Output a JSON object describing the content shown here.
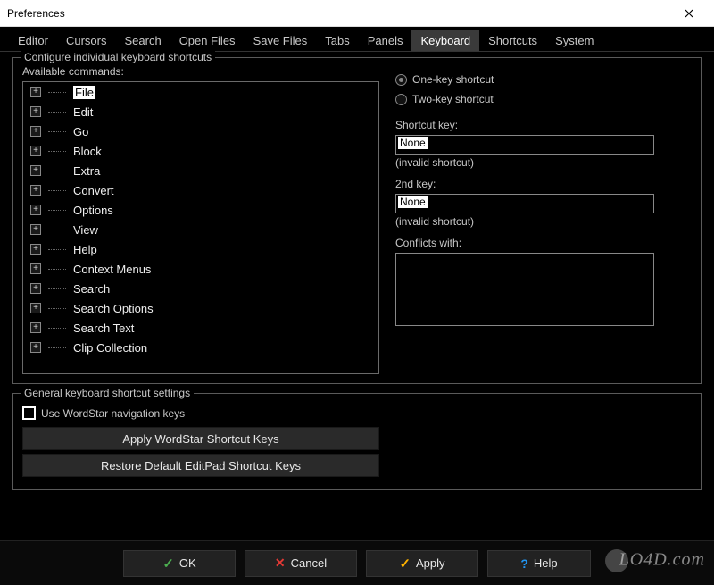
{
  "window": {
    "title": "Preferences"
  },
  "tabs": [
    {
      "label": "Editor"
    },
    {
      "label": "Cursors"
    },
    {
      "label": "Search"
    },
    {
      "label": "Open Files"
    },
    {
      "label": "Save Files"
    },
    {
      "label": "Tabs"
    },
    {
      "label": "Panels"
    },
    {
      "label": "Keyboard",
      "active": true
    },
    {
      "label": "Shortcuts"
    },
    {
      "label": "System"
    }
  ],
  "config_group": {
    "title": "Configure individual keyboard shortcuts",
    "available_label": "Available commands:",
    "commands": [
      {
        "label": "File",
        "focused": true
      },
      {
        "label": "Edit"
      },
      {
        "label": "Go"
      },
      {
        "label": "Block"
      },
      {
        "label": "Extra"
      },
      {
        "label": "Convert"
      },
      {
        "label": "Options"
      },
      {
        "label": "View"
      },
      {
        "label": "Help"
      },
      {
        "label": "Context Menus"
      },
      {
        "label": "Search"
      },
      {
        "label": "Search Options"
      },
      {
        "label": "Search Text"
      },
      {
        "label": "Clip Collection"
      }
    ],
    "radio_one": "One-key shortcut",
    "radio_two": "Two-key shortcut",
    "shortcut_key_label": "Shortcut key:",
    "shortcut_key_value": "None",
    "shortcut_key_status": "(invalid shortcut)",
    "second_key_label": "2nd key:",
    "second_key_value": "None",
    "second_key_status": "(invalid shortcut)",
    "conflicts_label": "Conflicts with:"
  },
  "general_group": {
    "title": "General keyboard shortcut settings",
    "checkbox_label": "Use WordStar navigation keys",
    "btn_wordstar": "Apply WordStar Shortcut Keys",
    "btn_restore": "Restore Default EditPad Shortcut Keys"
  },
  "footer": {
    "ok": "OK",
    "cancel": "Cancel",
    "apply": "Apply",
    "help": "Help"
  },
  "watermark": "LO4D.com"
}
